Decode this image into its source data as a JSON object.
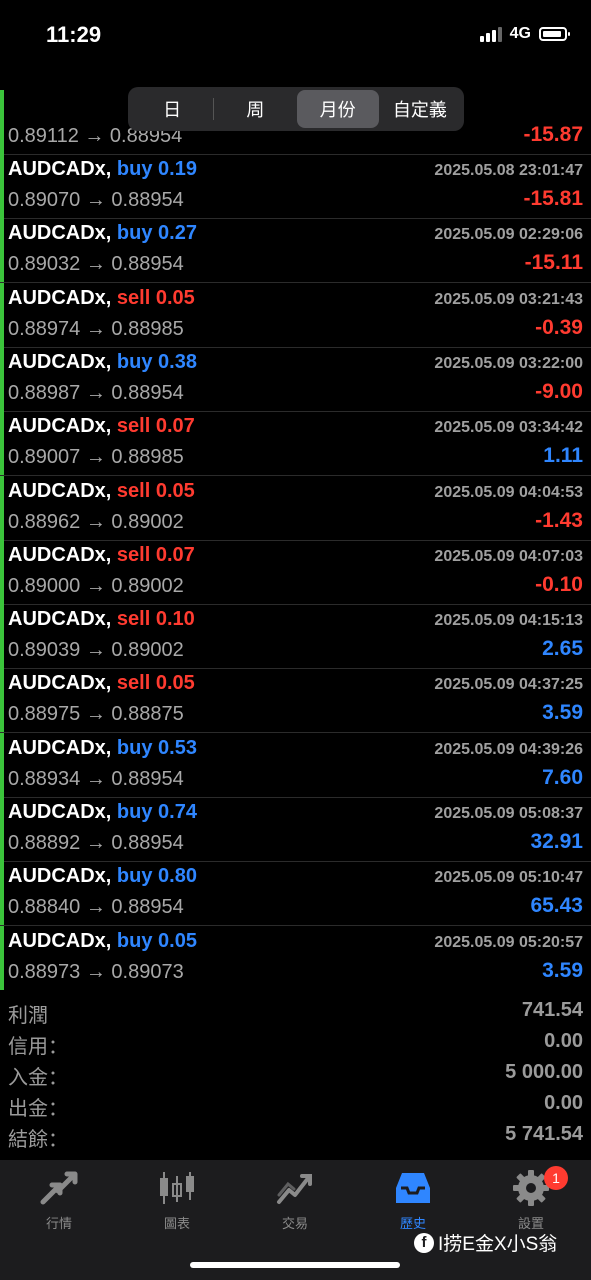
{
  "status_bar": {
    "time": "11:29",
    "network": "4G"
  },
  "period_tabs": [
    {
      "label": "日",
      "active": false
    },
    {
      "label": "周",
      "active": false
    },
    {
      "label": "月份",
      "active": true
    },
    {
      "label": "自定義",
      "active": false
    }
  ],
  "partial_row": {
    "prices": "0.89112 → 0.88954",
    "profit": "-15.87"
  },
  "deals": [
    {
      "symbol": "AUDCADx,",
      "side": "buy",
      "lots": "0.19",
      "time": "2025.05.08 23:01:47",
      "prices": "0.89070 → 0.88954",
      "profit": "-15.81"
    },
    {
      "symbol": "AUDCADx,",
      "side": "buy",
      "lots": "0.27",
      "time": "2025.05.09 02:29:06",
      "prices": "0.89032 → 0.88954",
      "profit": "-15.11"
    },
    {
      "symbol": "AUDCADx,",
      "side": "sell",
      "lots": "0.05",
      "time": "2025.05.09 03:21:43",
      "prices": "0.88974 → 0.88985",
      "profit": "-0.39"
    },
    {
      "symbol": "AUDCADx,",
      "side": "buy",
      "lots": "0.38",
      "time": "2025.05.09 03:22:00",
      "prices": "0.88987 → 0.88954",
      "profit": "-9.00"
    },
    {
      "symbol": "AUDCADx,",
      "side": "sell",
      "lots": "0.07",
      "time": "2025.05.09 03:34:42",
      "prices": "0.89007 → 0.88985",
      "profit": "1.11"
    },
    {
      "symbol": "AUDCADx,",
      "side": "sell",
      "lots": "0.05",
      "time": "2025.05.09 04:04:53",
      "prices": "0.88962 → 0.89002",
      "profit": "-1.43"
    },
    {
      "symbol": "AUDCADx,",
      "side": "sell",
      "lots": "0.07",
      "time": "2025.05.09 04:07:03",
      "prices": "0.89000 → 0.89002",
      "profit": "-0.10"
    },
    {
      "symbol": "AUDCADx,",
      "side": "sell",
      "lots": "0.10",
      "time": "2025.05.09 04:15:13",
      "prices": "0.89039 → 0.89002",
      "profit": "2.65"
    },
    {
      "symbol": "AUDCADx,",
      "side": "sell",
      "lots": "0.05",
      "time": "2025.05.09 04:37:25",
      "prices": "0.88975 → 0.88875",
      "profit": "3.59"
    },
    {
      "symbol": "AUDCADx,",
      "side": "buy",
      "lots": "0.53",
      "time": "2025.05.09 04:39:26",
      "prices": "0.88934 → 0.88954",
      "profit": "7.60"
    },
    {
      "symbol": "AUDCADx,",
      "side": "buy",
      "lots": "0.74",
      "time": "2025.05.09 05:08:37",
      "prices": "0.88892 → 0.88954",
      "profit": "32.91"
    },
    {
      "symbol": "AUDCADx,",
      "side": "buy",
      "lots": "0.80",
      "time": "2025.05.09 05:10:47",
      "prices": "0.88840 → 0.88954",
      "profit": "65.43"
    },
    {
      "symbol": "AUDCADx,",
      "side": "buy",
      "lots": "0.05",
      "time": "2025.05.09 05:20:57",
      "prices": "0.88973 → 0.89073",
      "profit": "3.59"
    }
  ],
  "summary": [
    {
      "label": "利潤",
      "value": "741.54"
    },
    {
      "label": "信用：",
      "value": "0.00"
    },
    {
      "label": "入金：",
      "value": "5 000.00"
    },
    {
      "label": "出金：",
      "value": "0.00"
    },
    {
      "label": "結餘：",
      "value": "5 741.54"
    }
  ],
  "tabbar": [
    {
      "label": "行情",
      "icon": "quotes-arrows-icon",
      "active": false
    },
    {
      "label": "圖表",
      "icon": "candlestick-chart-icon",
      "active": false
    },
    {
      "label": "交易",
      "icon": "trade-trend-icon",
      "active": false
    },
    {
      "label": "歷史",
      "icon": "history-inbox-icon",
      "active": true
    },
    {
      "label": "設置",
      "icon": "gear-icon",
      "active": false,
      "badge": "1"
    }
  ],
  "watermark": {
    "text": "I捞E金X小S翁"
  },
  "colors": {
    "buy": "#2f86ff",
    "sell": "#ff3b30",
    "row_marker": "#3bc43b",
    "background": "#000000"
  }
}
